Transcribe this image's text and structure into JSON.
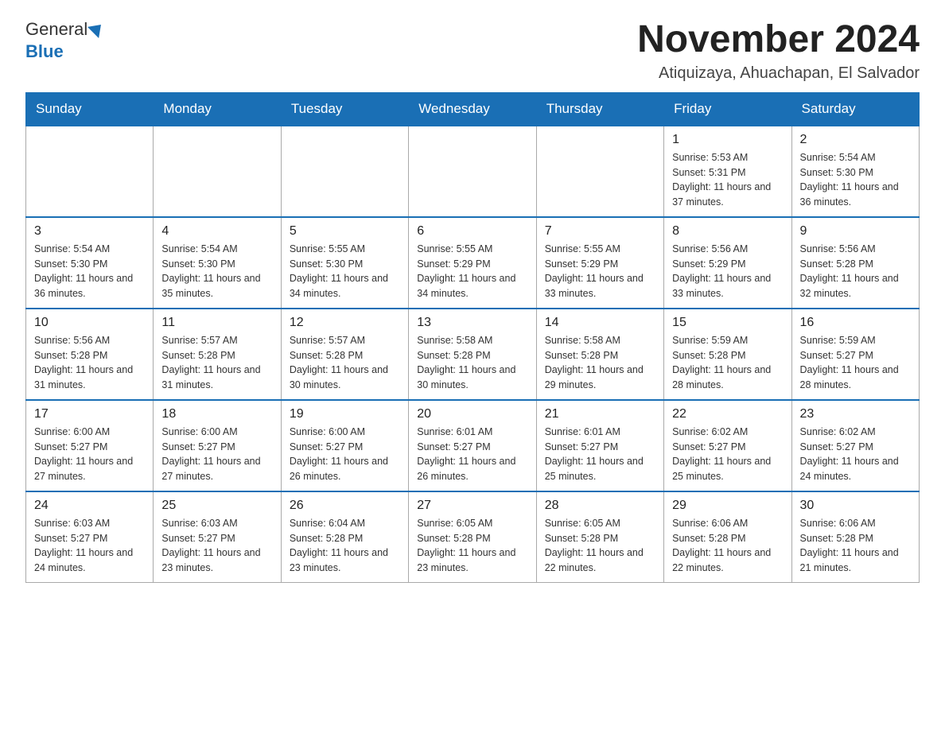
{
  "logo": {
    "general": "General",
    "blue": "Blue"
  },
  "title": "November 2024",
  "subtitle": "Atiquizaya, Ahuachapan, El Salvador",
  "days_of_week": [
    "Sunday",
    "Monday",
    "Tuesday",
    "Wednesday",
    "Thursday",
    "Friday",
    "Saturday"
  ],
  "weeks": [
    [
      {
        "day": "",
        "info": ""
      },
      {
        "day": "",
        "info": ""
      },
      {
        "day": "",
        "info": ""
      },
      {
        "day": "",
        "info": ""
      },
      {
        "day": "",
        "info": ""
      },
      {
        "day": "1",
        "info": "Sunrise: 5:53 AM\nSunset: 5:31 PM\nDaylight: 11 hours and 37 minutes."
      },
      {
        "day": "2",
        "info": "Sunrise: 5:54 AM\nSunset: 5:30 PM\nDaylight: 11 hours and 36 minutes."
      }
    ],
    [
      {
        "day": "3",
        "info": "Sunrise: 5:54 AM\nSunset: 5:30 PM\nDaylight: 11 hours and 36 minutes."
      },
      {
        "day": "4",
        "info": "Sunrise: 5:54 AM\nSunset: 5:30 PM\nDaylight: 11 hours and 35 minutes."
      },
      {
        "day": "5",
        "info": "Sunrise: 5:55 AM\nSunset: 5:30 PM\nDaylight: 11 hours and 34 minutes."
      },
      {
        "day": "6",
        "info": "Sunrise: 5:55 AM\nSunset: 5:29 PM\nDaylight: 11 hours and 34 minutes."
      },
      {
        "day": "7",
        "info": "Sunrise: 5:55 AM\nSunset: 5:29 PM\nDaylight: 11 hours and 33 minutes."
      },
      {
        "day": "8",
        "info": "Sunrise: 5:56 AM\nSunset: 5:29 PM\nDaylight: 11 hours and 33 minutes."
      },
      {
        "day": "9",
        "info": "Sunrise: 5:56 AM\nSunset: 5:28 PM\nDaylight: 11 hours and 32 minutes."
      }
    ],
    [
      {
        "day": "10",
        "info": "Sunrise: 5:56 AM\nSunset: 5:28 PM\nDaylight: 11 hours and 31 minutes."
      },
      {
        "day": "11",
        "info": "Sunrise: 5:57 AM\nSunset: 5:28 PM\nDaylight: 11 hours and 31 minutes."
      },
      {
        "day": "12",
        "info": "Sunrise: 5:57 AM\nSunset: 5:28 PM\nDaylight: 11 hours and 30 minutes."
      },
      {
        "day": "13",
        "info": "Sunrise: 5:58 AM\nSunset: 5:28 PM\nDaylight: 11 hours and 30 minutes."
      },
      {
        "day": "14",
        "info": "Sunrise: 5:58 AM\nSunset: 5:28 PM\nDaylight: 11 hours and 29 minutes."
      },
      {
        "day": "15",
        "info": "Sunrise: 5:59 AM\nSunset: 5:28 PM\nDaylight: 11 hours and 28 minutes."
      },
      {
        "day": "16",
        "info": "Sunrise: 5:59 AM\nSunset: 5:27 PM\nDaylight: 11 hours and 28 minutes."
      }
    ],
    [
      {
        "day": "17",
        "info": "Sunrise: 6:00 AM\nSunset: 5:27 PM\nDaylight: 11 hours and 27 minutes."
      },
      {
        "day": "18",
        "info": "Sunrise: 6:00 AM\nSunset: 5:27 PM\nDaylight: 11 hours and 27 minutes."
      },
      {
        "day": "19",
        "info": "Sunrise: 6:00 AM\nSunset: 5:27 PM\nDaylight: 11 hours and 26 minutes."
      },
      {
        "day": "20",
        "info": "Sunrise: 6:01 AM\nSunset: 5:27 PM\nDaylight: 11 hours and 26 minutes."
      },
      {
        "day": "21",
        "info": "Sunrise: 6:01 AM\nSunset: 5:27 PM\nDaylight: 11 hours and 25 minutes."
      },
      {
        "day": "22",
        "info": "Sunrise: 6:02 AM\nSunset: 5:27 PM\nDaylight: 11 hours and 25 minutes."
      },
      {
        "day": "23",
        "info": "Sunrise: 6:02 AM\nSunset: 5:27 PM\nDaylight: 11 hours and 24 minutes."
      }
    ],
    [
      {
        "day": "24",
        "info": "Sunrise: 6:03 AM\nSunset: 5:27 PM\nDaylight: 11 hours and 24 minutes."
      },
      {
        "day": "25",
        "info": "Sunrise: 6:03 AM\nSunset: 5:27 PM\nDaylight: 11 hours and 23 minutes."
      },
      {
        "day": "26",
        "info": "Sunrise: 6:04 AM\nSunset: 5:28 PM\nDaylight: 11 hours and 23 minutes."
      },
      {
        "day": "27",
        "info": "Sunrise: 6:05 AM\nSunset: 5:28 PM\nDaylight: 11 hours and 23 minutes."
      },
      {
        "day": "28",
        "info": "Sunrise: 6:05 AM\nSunset: 5:28 PM\nDaylight: 11 hours and 22 minutes."
      },
      {
        "day": "29",
        "info": "Sunrise: 6:06 AM\nSunset: 5:28 PM\nDaylight: 11 hours and 22 minutes."
      },
      {
        "day": "30",
        "info": "Sunrise: 6:06 AM\nSunset: 5:28 PM\nDaylight: 11 hours and 21 minutes."
      }
    ]
  ]
}
